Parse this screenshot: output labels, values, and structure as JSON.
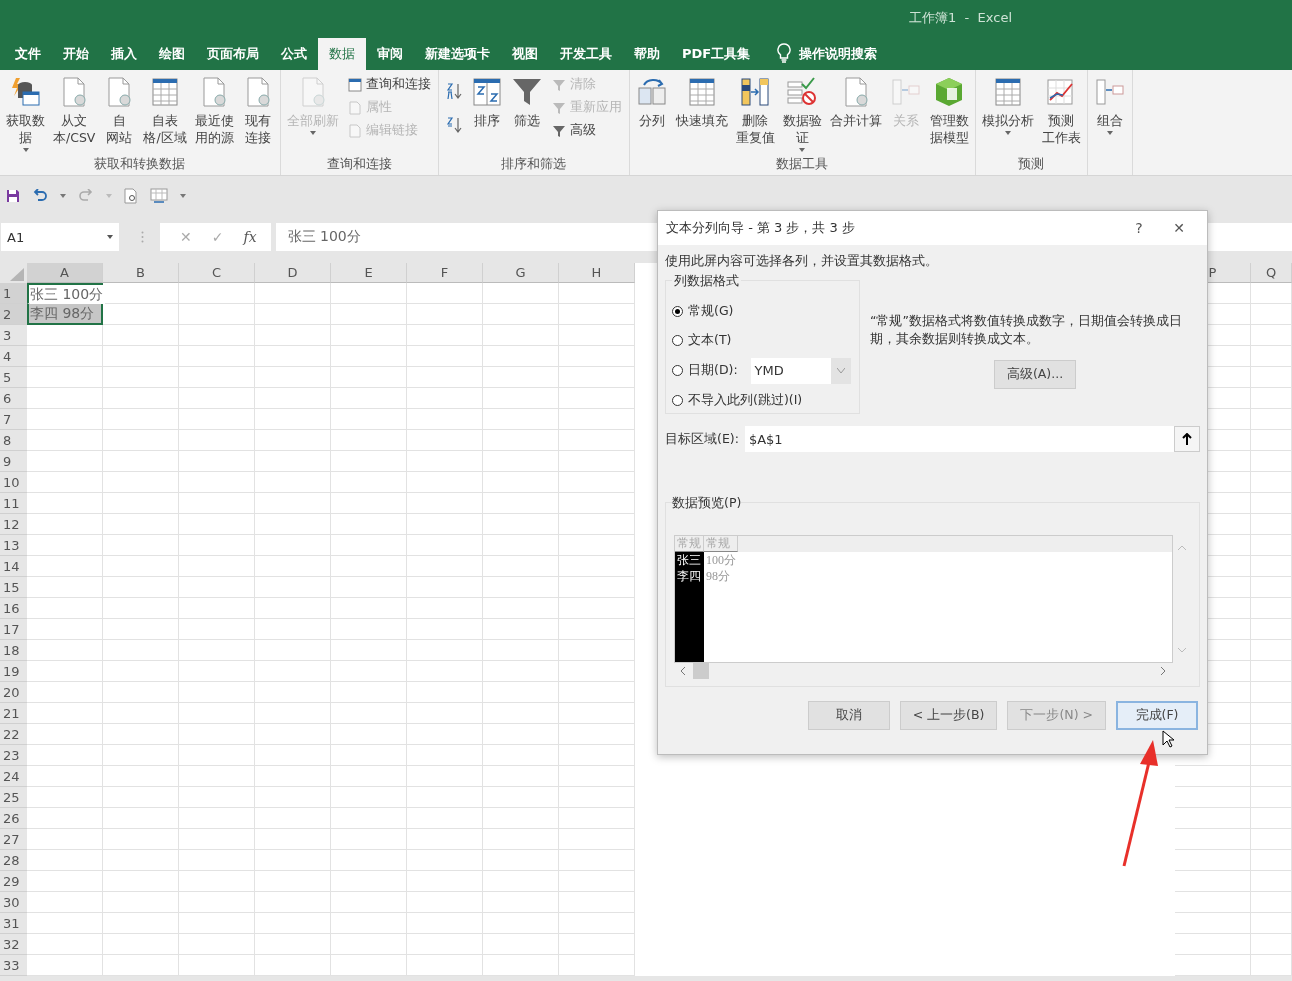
{
  "window": {
    "title": "工作簿1  -  Excel"
  },
  "tabs": [
    {
      "label": "文件",
      "selected": false
    },
    {
      "label": "开始",
      "selected": false
    },
    {
      "label": "插入",
      "selected": false
    },
    {
      "label": "绘图",
      "selected": false
    },
    {
      "label": "页面布局",
      "selected": false
    },
    {
      "label": "公式",
      "selected": false
    },
    {
      "label": "数据",
      "selected": true
    },
    {
      "label": "审阅",
      "selected": false
    },
    {
      "label": "新建选项卡",
      "selected": false
    },
    {
      "label": "视图",
      "selected": false
    },
    {
      "label": "开发工具",
      "selected": false
    },
    {
      "label": "帮助",
      "selected": false
    },
    {
      "label": "PDF工具集",
      "selected": false
    }
  ],
  "tell_me": "操作说明搜索",
  "ribbon": {
    "groups": [
      {
        "label": "获取和转换数据",
        "items": [
          {
            "kind": "large",
            "label": "获取数据",
            "dropdown": true,
            "disabled": false
          },
          {
            "kind": "large",
            "label": "从文本/CSV",
            "dropdown": false,
            "disabled": false
          },
          {
            "kind": "large",
            "label": "自网站",
            "dropdown": false,
            "disabled": false
          },
          {
            "kind": "large",
            "label": "自表格/区域",
            "dropdown": false,
            "disabled": false
          },
          {
            "kind": "large",
            "label": "最近使用的源",
            "dropdown": false,
            "disabled": false
          },
          {
            "kind": "large",
            "label": "现有连接",
            "dropdown": false,
            "disabled": false
          }
        ]
      },
      {
        "label": "查询和连接",
        "items": [
          {
            "kind": "large",
            "label": "全部刷新",
            "dropdown": true,
            "disabled": true
          },
          {
            "kind": "stack",
            "items": [
              {
                "label": "查询和连接",
                "disabled": false
              },
              {
                "label": "属性",
                "disabled": true
              },
              {
                "label": "编辑链接",
                "disabled": true
              }
            ]
          }
        ]
      },
      {
        "label": "排序和筛选",
        "items": [
          {
            "kind": "sort-icons"
          },
          {
            "kind": "large",
            "label": "排序",
            "dropdown": false,
            "disabled": false
          },
          {
            "kind": "large",
            "label": "筛选",
            "dropdown": false,
            "disabled": false
          },
          {
            "kind": "stack",
            "items": [
              {
                "label": "清除",
                "disabled": true
              },
              {
                "label": "重新应用",
                "disabled": true
              },
              {
                "label": "高级",
                "disabled": false
              }
            ]
          }
        ]
      },
      {
        "label": "数据工具",
        "items": [
          {
            "kind": "large",
            "label": "分列",
            "dropdown": false,
            "disabled": false
          },
          {
            "kind": "large",
            "label": "快速填充",
            "dropdown": false,
            "disabled": false
          },
          {
            "kind": "large",
            "label": "删除重复值",
            "dropdown": false,
            "disabled": false
          },
          {
            "kind": "large",
            "label": "数据验证",
            "dropdown": true,
            "disabled": false
          },
          {
            "kind": "large",
            "label": "合并计算",
            "dropdown": false,
            "disabled": false
          },
          {
            "kind": "large",
            "label": "关系",
            "dropdown": false,
            "disabled": true
          },
          {
            "kind": "large",
            "label": "管理数据模型",
            "dropdown": false,
            "disabled": false
          }
        ]
      },
      {
        "label": "预测",
        "items": [
          {
            "kind": "large",
            "label": "模拟分析",
            "dropdown": true,
            "disabled": false
          },
          {
            "kind": "large",
            "label": "预测工作表",
            "dropdown": false,
            "disabled": false
          }
        ]
      },
      {
        "items": [
          {
            "kind": "large",
            "label": "组合",
            "dropdown": true,
            "disabled": false
          }
        ]
      }
    ]
  },
  "formula_bar": {
    "name_box": "A1",
    "cancel": "✕",
    "enter": "✓",
    "fx": "fx",
    "value": "张三  100分"
  },
  "sheet": {
    "columns": [
      {
        "label": "A",
        "selected": true
      },
      {
        "label": "B",
        "selected": false
      },
      {
        "label": "C",
        "selected": false
      },
      {
        "label": "D",
        "selected": false
      },
      {
        "label": "E",
        "selected": false
      },
      {
        "label": "F",
        "selected": false
      },
      {
        "label": "G",
        "selected": false
      },
      {
        "label": "H",
        "selected": false
      },
      {
        "label": "P",
        "selected": false
      },
      {
        "label": "Q",
        "selected": false
      }
    ],
    "rows": [
      {
        "label": "1",
        "selected": true,
        "cells": [
          {
            "text": "张三  100分",
            "selected": true,
            "active": true
          }
        ]
      },
      {
        "label": "2",
        "selected": true,
        "cells": [
          {
            "text": "李四  98分",
            "selected": true,
            "active": false
          }
        ]
      },
      {
        "label": "3",
        "selected": false
      },
      {
        "label": "4",
        "selected": false
      },
      {
        "label": "5",
        "selected": false
      },
      {
        "label": "6",
        "selected": false
      },
      {
        "label": "7",
        "selected": false
      },
      {
        "label": "8",
        "selected": false
      },
      {
        "label": "9",
        "selected": false
      },
      {
        "label": "10",
        "selected": false
      },
      {
        "label": "11",
        "selected": false
      },
      {
        "label": "12",
        "selected": false
      },
      {
        "label": "13",
        "selected": false
      },
      {
        "label": "14",
        "selected": false
      },
      {
        "label": "15",
        "selected": false
      },
      {
        "label": "16",
        "selected": false
      },
      {
        "label": "17",
        "selected": false
      },
      {
        "label": "18",
        "selected": false
      },
      {
        "label": "19",
        "selected": false
      },
      {
        "label": "20",
        "selected": false
      },
      {
        "label": "21",
        "selected": false
      },
      {
        "label": "22",
        "selected": false
      },
      {
        "label": "23",
        "selected": false
      },
      {
        "label": "24",
        "selected": false
      },
      {
        "label": "25",
        "selected": false
      },
      {
        "label": "26",
        "selected": false
      },
      {
        "label": "27",
        "selected": false
      },
      {
        "label": "28",
        "selected": false
      },
      {
        "label": "29",
        "selected": false
      },
      {
        "label": "30",
        "selected": false
      },
      {
        "label": "31",
        "selected": false
      },
      {
        "label": "32",
        "selected": false
      },
      {
        "label": "33",
        "selected": false
      }
    ]
  },
  "dialog": {
    "title": "文本分列向导 - 第 3 步，共 3 步",
    "help": "?",
    "close": "✕",
    "intro": "使用此屏内容可选择各列，并设置其数据格式。",
    "format_group": "列数据格式",
    "formats": [
      {
        "label": "常规(G)",
        "selected": true,
        "kind": "plain"
      },
      {
        "label": "文本(T)",
        "selected": false,
        "kind": "plain"
      },
      {
        "label": "日期(D):",
        "selected": false,
        "kind": "date",
        "select": "YMD"
      },
      {
        "label": "不导入此列(跳过)(I)",
        "selected": false,
        "kind": "plain"
      }
    ],
    "description": "“常规”数据格式将数值转换成数字，日期值会转换成日期，其余数据则转换成文本。",
    "advanced": "高级(A)...",
    "target_label": "目标区域(E):",
    "target_value": "$A$1",
    "preview_group": "数据预览(P)",
    "preview": {
      "columns": [
        {
          "header": "常规",
          "selected": true
        },
        {
          "header": "常规",
          "selected": false
        }
      ],
      "rows": [
        [
          "张三",
          "100分"
        ],
        [
          "李四",
          "98分"
        ]
      ]
    },
    "buttons": [
      {
        "label": "取消",
        "disabled": false,
        "default": false
      },
      {
        "label": "< 上一步(B)",
        "disabled": false,
        "default": false
      },
      {
        "label": "下一步(N) >",
        "disabled": true,
        "default": false
      },
      {
        "label": "完成(F)",
        "disabled": false,
        "default": true
      }
    ]
  }
}
